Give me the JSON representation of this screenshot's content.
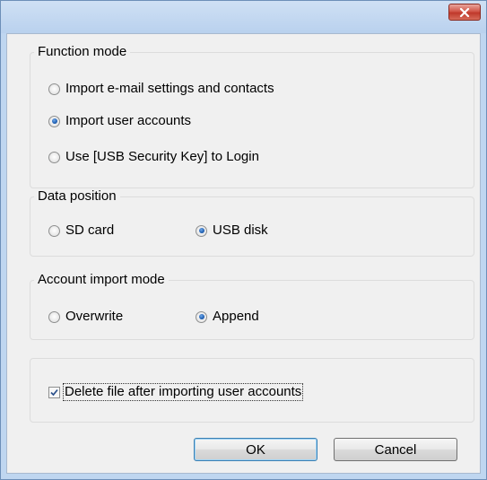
{
  "window": {
    "close_icon": "close-icon",
    "close_color": "#c0392b"
  },
  "function_mode": {
    "title": "Function mode",
    "options": [
      {
        "label": "Import e-mail settings and contacts",
        "checked": false
      },
      {
        "label": "Import user accounts",
        "checked": true
      },
      {
        "label": "Use [USB Security Key] to Login",
        "checked": false
      }
    ]
  },
  "data_position": {
    "title": "Data position",
    "options": [
      {
        "label": "SD card",
        "checked": false
      },
      {
        "label": "USB disk",
        "checked": true
      }
    ]
  },
  "account_import_mode": {
    "title": "Account import mode",
    "options": [
      {
        "label": "Overwrite",
        "checked": false
      },
      {
        "label": "Append",
        "checked": true
      }
    ]
  },
  "delete_option": {
    "label": "Delete file after importing user accounts",
    "checked": true
  },
  "buttons": {
    "ok": "OK",
    "cancel": "Cancel"
  }
}
